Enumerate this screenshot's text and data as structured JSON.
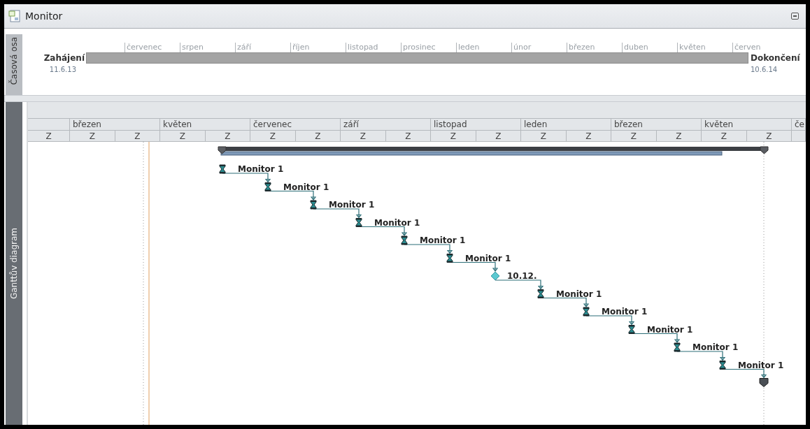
{
  "window": {
    "title": "Monitor"
  },
  "timeline": {
    "tab": "Časová osa",
    "start": {
      "label": "Zahájení",
      "date": "11.6.13"
    },
    "end": {
      "label": "Dokončení",
      "date": "10.6.14"
    },
    "months": [
      "červenec",
      "srpen",
      "září",
      "říjen",
      "listopad",
      "prosinec",
      "leden",
      "únor",
      "březen",
      "duben",
      "květen",
      "červen"
    ]
  },
  "gantt": {
    "tab": "Ganttův diagram",
    "months": [
      "březen",
      "květen",
      "červenec",
      "září",
      "listopad",
      "leden",
      "březen",
      "květen"
    ],
    "cut_month": "če",
    "units": [
      "Z",
      "Z",
      "Z",
      "Z",
      "Z",
      "Z",
      "Z",
      "Z",
      "Z",
      "Z",
      "Z",
      "Z",
      "Z",
      "Z",
      "Z",
      "Z",
      "Z"
    ],
    "tasks": [
      {
        "kind": "task",
        "label": "Monitor 1"
      },
      {
        "kind": "task",
        "label": "Monitor 1"
      },
      {
        "kind": "task",
        "label": "Monitor 1"
      },
      {
        "kind": "task",
        "label": "Monitor 1"
      },
      {
        "kind": "task",
        "label": "Monitor 1"
      },
      {
        "kind": "task",
        "label": "Monitor 1"
      },
      {
        "kind": "milestone",
        "label": "10.12."
      },
      {
        "kind": "task",
        "label": "Monitor 1"
      },
      {
        "kind": "task",
        "label": "Monitor 1"
      },
      {
        "kind": "task",
        "label": "Monitor 1"
      },
      {
        "kind": "task",
        "label": "Monitor 1"
      },
      {
        "kind": "task",
        "label": "Monitor 1"
      }
    ]
  }
}
